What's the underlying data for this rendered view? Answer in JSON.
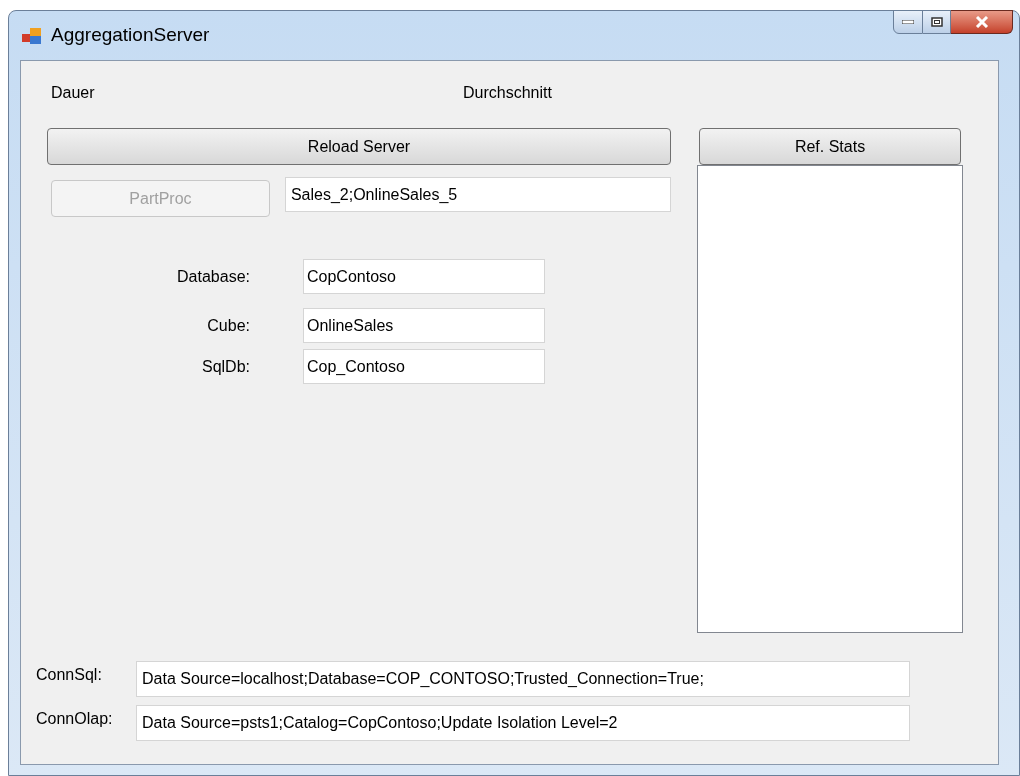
{
  "window": {
    "title": "AggregationServer"
  },
  "header_labels": [
    "Dauer",
    "Durchschnitt"
  ],
  "buttons": [
    {
      "label": "Reload Server",
      "disabled": false
    },
    {
      "label": "Ref. Stats",
      "disabled": false
    },
    {
      "label": "PartProc",
      "disabled": true
    }
  ],
  "partitions_field": {
    "value": "Sales_2;OnlineSales_5"
  },
  "fields": [
    {
      "label": "Database:",
      "value": "CopContoso"
    },
    {
      "label": "Cube:",
      "value": "OnlineSales"
    },
    {
      "label": "SqlDb:",
      "value": "Cop_Contoso"
    }
  ],
  "connections": [
    {
      "label": "ConnSql:",
      "value": "Data Source=localhost;Database=COP_CONTOSO;Trusted_Connection=True;"
    },
    {
      "label": "ConnOlap:",
      "value": "Data Source=psts1;Catalog=CopContoso;Update Isolation Level=2"
    }
  ]
}
